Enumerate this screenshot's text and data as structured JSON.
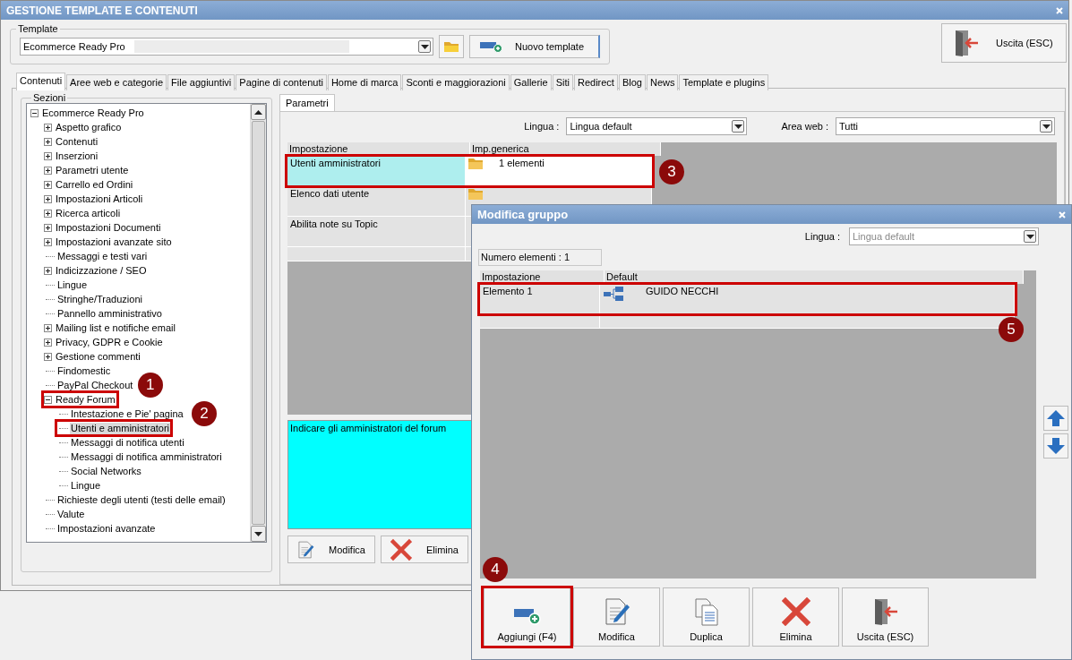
{
  "window": {
    "title": "GESTIONE TEMPLATE E CONTENUTI"
  },
  "template": {
    "label": "Template",
    "value": "Ecommerce Ready Pro",
    "new_button": "Nuovo template"
  },
  "exit_button": "Uscita (ESC)",
  "tabs": [
    {
      "label": "Contenuti",
      "selected": true
    },
    {
      "label": "Aree web e categorie",
      "selected": false
    },
    {
      "label": "File aggiuntivi",
      "selected": false
    },
    {
      "label": "Pagine di contenuti",
      "selected": false
    },
    {
      "label": "Home di marca",
      "selected": false
    },
    {
      "label": "Sconti e maggiorazioni",
      "selected": false
    },
    {
      "label": "Gallerie",
      "selected": false
    },
    {
      "label": "Siti",
      "selected": false
    },
    {
      "label": "Redirect",
      "selected": false
    },
    {
      "label": "Blog",
      "selected": false
    },
    {
      "label": "News",
      "selected": false
    },
    {
      "label": "Template e plugins",
      "selected": false
    }
  ],
  "sections": {
    "label": "Sezioni",
    "tree": [
      {
        "label": "Ecommerce Ready Pro",
        "expanded": true,
        "selected": false,
        "children": [
          {
            "label": "Aspetto grafico",
            "expanded": false,
            "selected": false
          },
          {
            "label": "Contenuti",
            "expanded": false,
            "selected": false
          },
          {
            "label": "Inserzioni",
            "expanded": false,
            "selected": false
          },
          {
            "label": "Parametri utente",
            "expanded": false,
            "selected": false
          },
          {
            "label": "Carrello ed Ordini",
            "expanded": false,
            "selected": false
          },
          {
            "label": "Impostazioni Articoli",
            "expanded": false,
            "selected": false
          },
          {
            "label": "Ricerca articoli",
            "expanded": false,
            "selected": false
          },
          {
            "label": "Impostazioni Documenti",
            "expanded": false,
            "selected": false
          },
          {
            "label": "Impostazioni avanzate sito",
            "expanded": false,
            "selected": false
          },
          {
            "label": "Messaggi e testi vari",
            "selected": false
          },
          {
            "label": "Indicizzazione / SEO",
            "expanded": false,
            "selected": false
          },
          {
            "label": "Lingue",
            "selected": false
          },
          {
            "label": "Stringhe/Traduzioni",
            "selected": false
          },
          {
            "label": "Pannello amministrativo",
            "selected": false
          },
          {
            "label": "Mailing list e notifiche email",
            "expanded": false,
            "selected": false
          },
          {
            "label": "Privacy, GDPR e Cookie",
            "expanded": false,
            "selected": false
          },
          {
            "label": "Gestione commenti",
            "expanded": false,
            "selected": false
          },
          {
            "label": "Findomestic",
            "selected": false
          },
          {
            "label": "PayPal Checkout",
            "selected": false
          },
          {
            "label": "Ready Forum",
            "expanded": true,
            "selected": false,
            "callout": "1",
            "children": [
              {
                "label": "Intestazione e Pie' pagina",
                "selected": false
              },
              {
                "label": "Utenti e amministratori",
                "selected": true,
                "callout": "2"
              },
              {
                "label": "Messaggi di notifica utenti",
                "selected": false
              },
              {
                "label": "Messaggi di notifica amministratori",
                "selected": false
              },
              {
                "label": "Social Networks",
                "selected": false
              },
              {
                "label": "Lingue",
                "selected": false
              }
            ]
          },
          {
            "label": "Richieste degli utenti (testi delle email)",
            "selected": false
          },
          {
            "label": "Valute",
            "selected": false
          },
          {
            "label": "Impostazioni avanzate",
            "selected": false
          }
        ]
      }
    ]
  },
  "params": {
    "tab": "Parametri",
    "lingua": {
      "label": "Lingua :",
      "value": "Lingua default"
    },
    "area_web": {
      "label": "Area web :",
      "value": "Tutti"
    },
    "table": {
      "columns": [
        "Impostazione",
        "Imp.generica"
      ],
      "rows": [
        {
          "name": "Utenti amministratori",
          "value": "1 elementi",
          "icon": true,
          "selected": true,
          "callout": "3"
        },
        {
          "name": "Elenco dati utente",
          "icon": true,
          "selected": false
        },
        {
          "name": "Abilita note su Topic",
          "icon": false,
          "selected": false
        }
      ]
    },
    "description": "Indicare gli amministratori del forum",
    "buttons": [
      {
        "kind": "edit",
        "label": "Modifica"
      },
      {
        "kind": "delete",
        "label": "Elimina"
      }
    ]
  },
  "dialog": {
    "title": "Modifica gruppo",
    "lingua": {
      "label": "Lingua :",
      "value": "Lingua default"
    },
    "count": "Numero elementi : 1",
    "table": {
      "columns": [
        "Impostazione",
        "Default"
      ],
      "rows": [
        {
          "name": "Elemento 1",
          "value": "GUIDO NECCHI",
          "callout": "5"
        }
      ]
    },
    "buttons": [
      {
        "kind": "add",
        "label": "Aggiungi (F4)",
        "callout": "4"
      },
      {
        "kind": "edit",
        "label": "Modifica"
      },
      {
        "kind": "duplicate",
        "label": "Duplica"
      },
      {
        "kind": "delete",
        "label": "Elimina"
      },
      {
        "kind": "exit",
        "label": "Uscita (ESC)"
      }
    ]
  }
}
